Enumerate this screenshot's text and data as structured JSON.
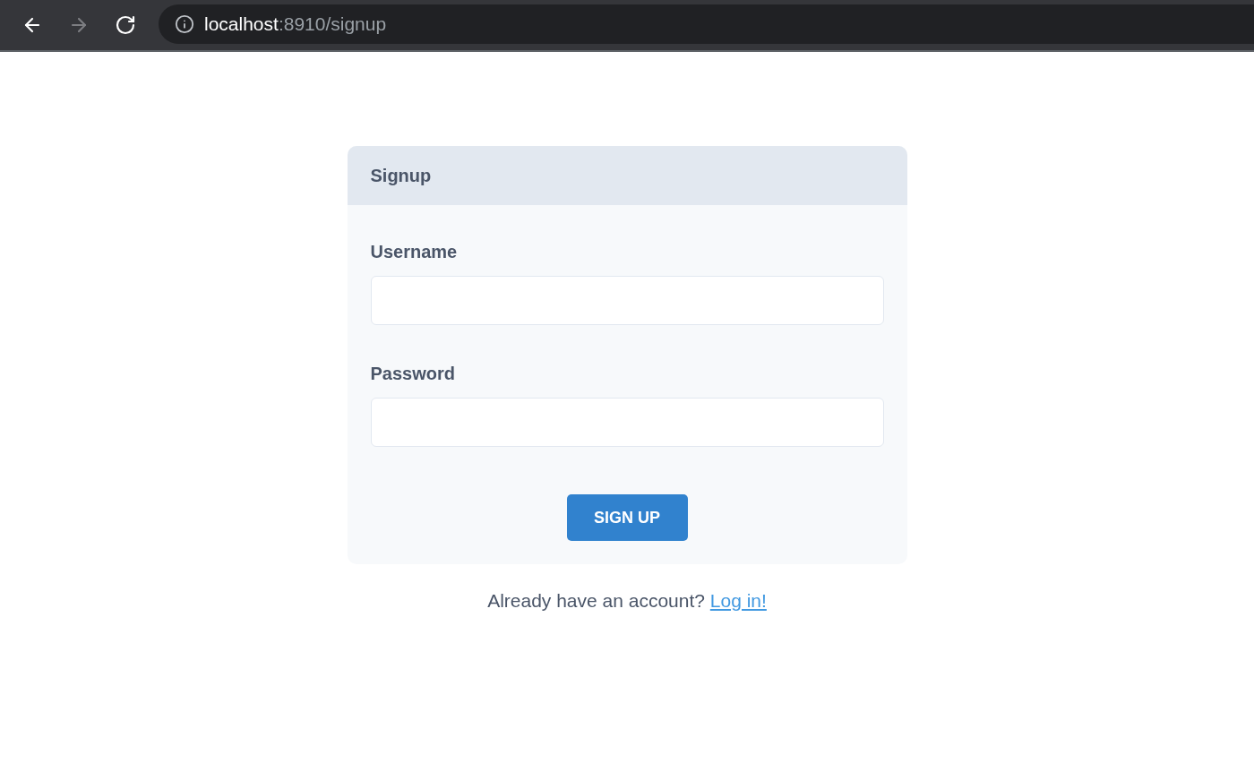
{
  "browser": {
    "nav_buttons": [
      {
        "kind": "back",
        "disabled": false
      },
      {
        "kind": "forward",
        "disabled": true
      },
      {
        "kind": "reload",
        "disabled": false
      }
    ],
    "address_bar": {
      "host": "localhost",
      "path": ":8910/signup"
    }
  },
  "card": {
    "title": "Signup",
    "fields": [
      {
        "label": "Username"
      },
      {
        "label": "Password"
      }
    ],
    "submit_button": "SIGN UP"
  },
  "footer": {
    "prompt": "Already have an account?",
    "link": "Log in!"
  }
}
